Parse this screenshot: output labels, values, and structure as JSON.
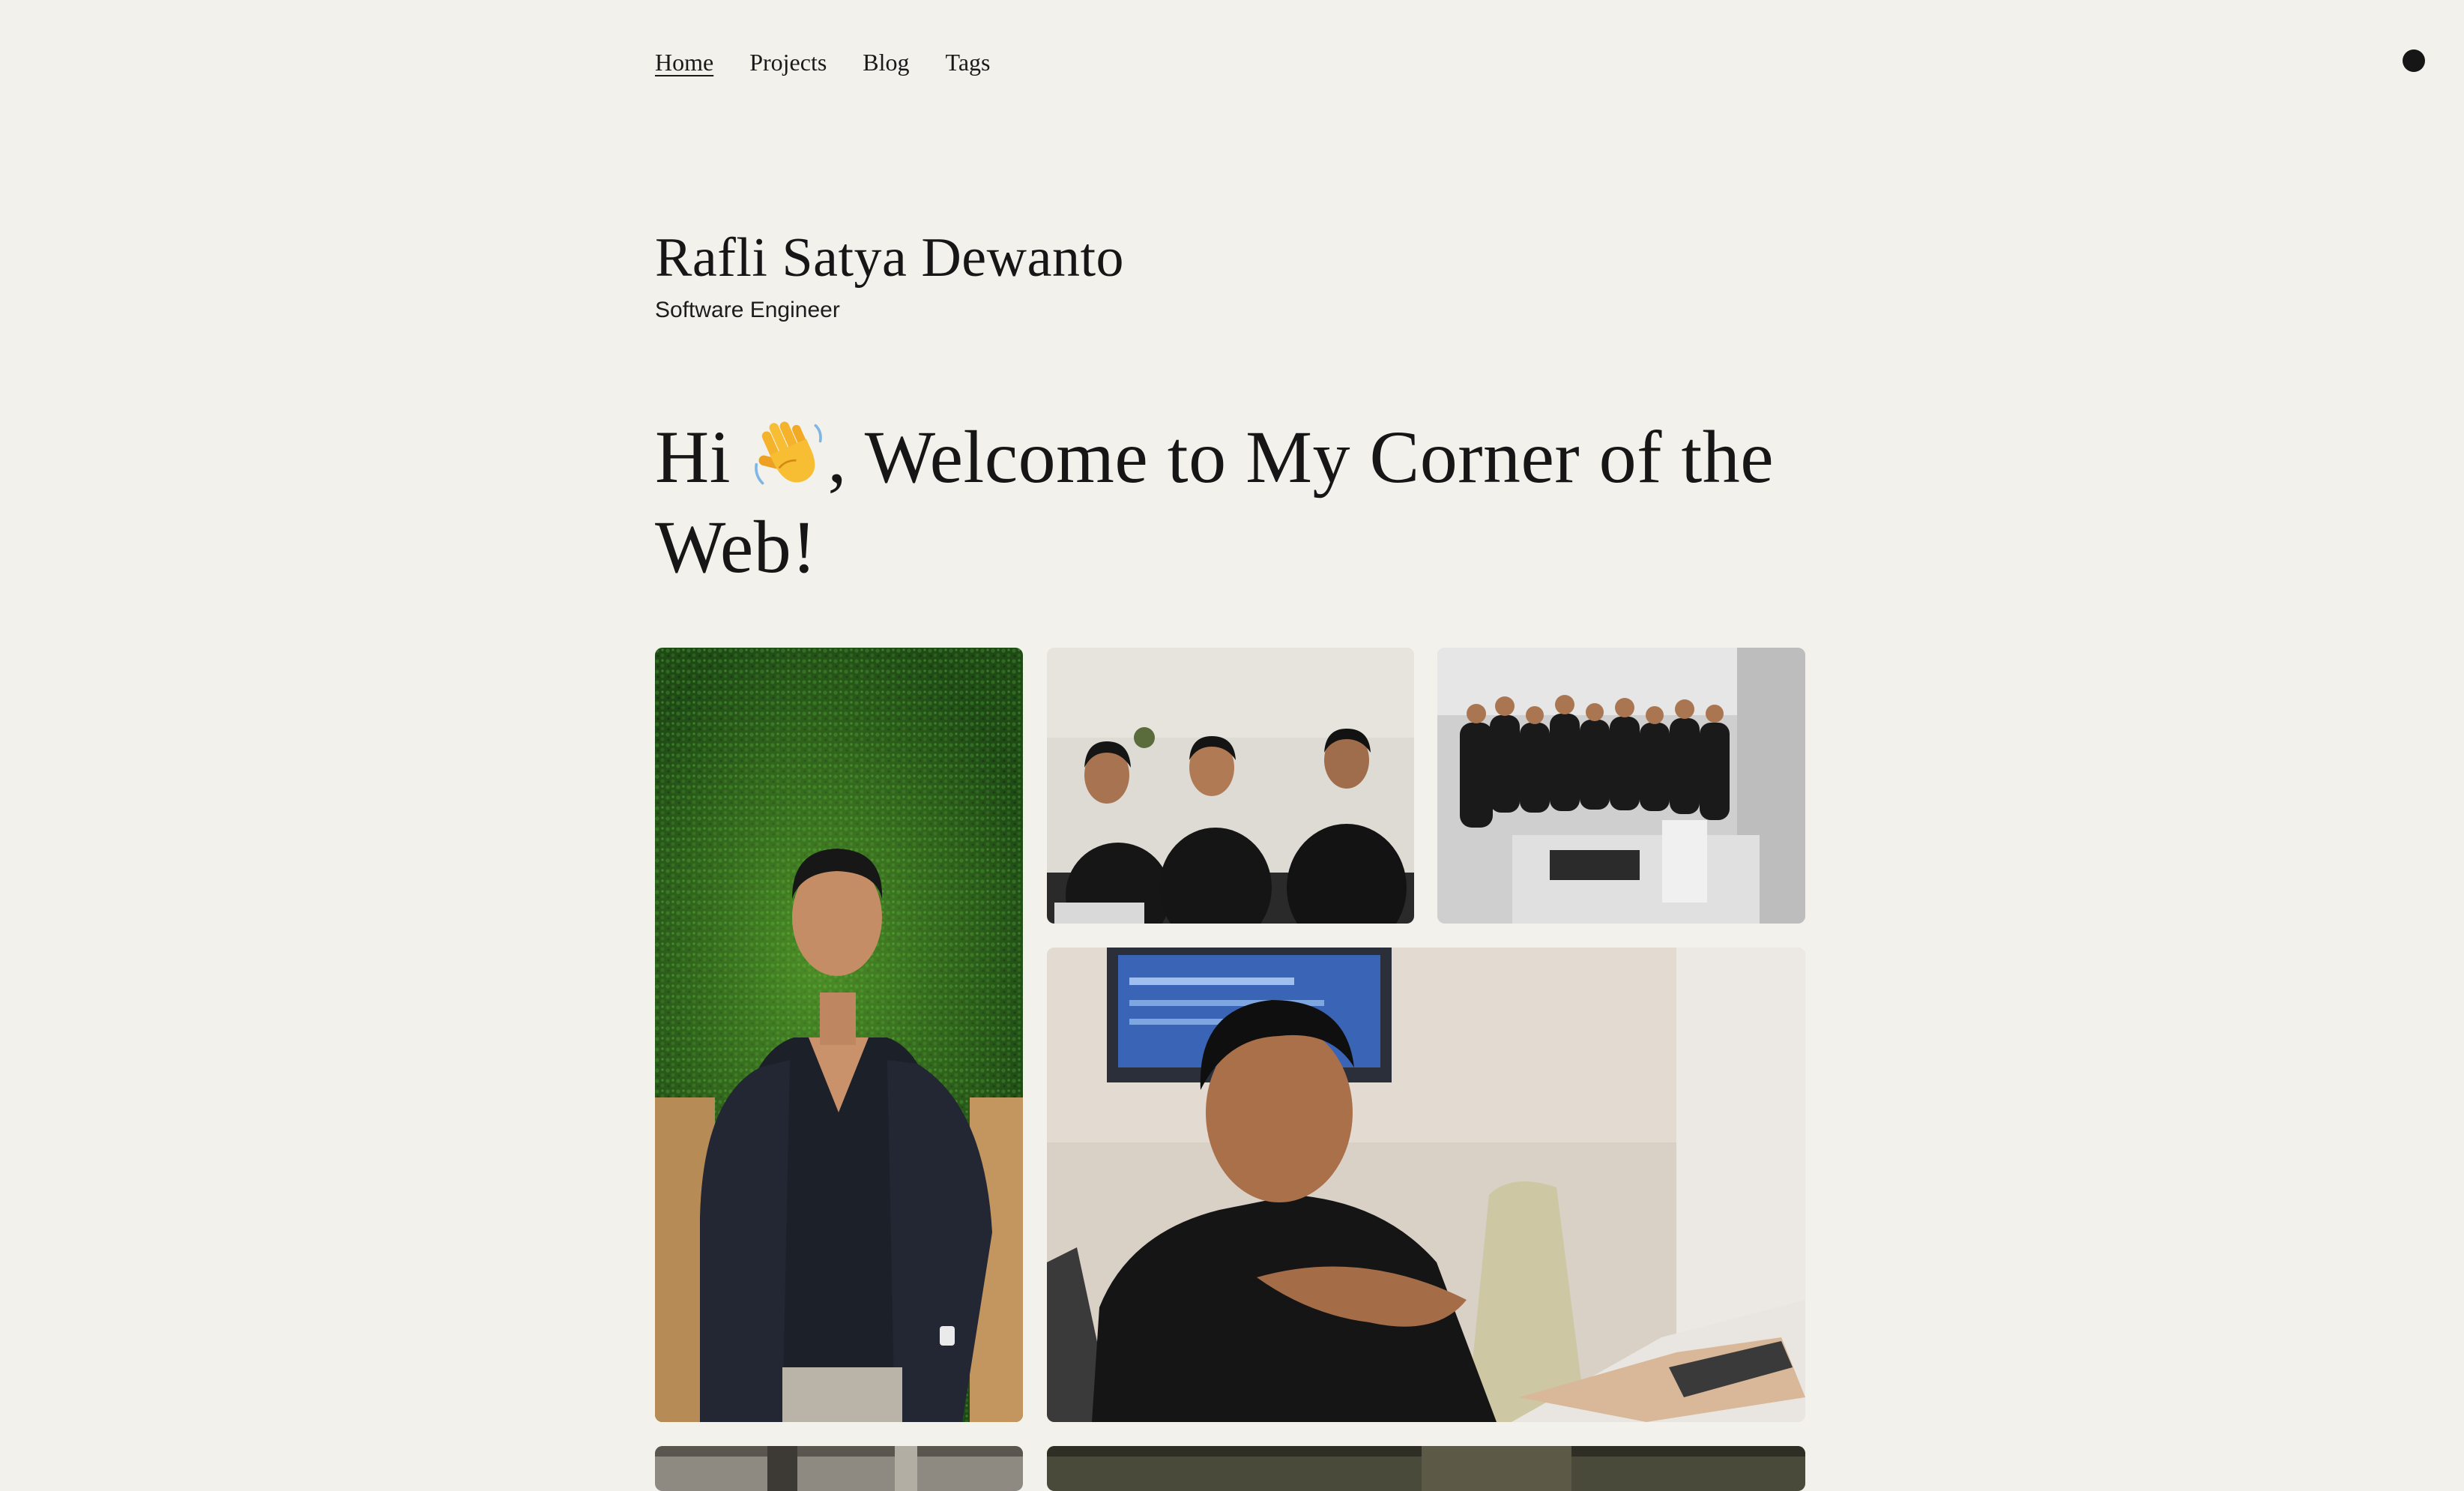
{
  "nav": {
    "items": [
      {
        "label": "Home",
        "active": true
      },
      {
        "label": "Projects",
        "active": false
      },
      {
        "label": "Blog",
        "active": false
      },
      {
        "label": "Tags",
        "active": false
      }
    ],
    "theme_toggle_icon": "theme-toggle-circle-icon"
  },
  "header": {
    "name": "Rafli Satya Dewanto",
    "role": "Software Engineer"
  },
  "welcome": {
    "heading_before_emoji": "Hi ",
    "emoji": "👋",
    "heading_after_emoji": ", Welcome to My Corner of the Web!"
  },
  "gallery": {
    "photos": [
      {
        "name": "portrait-green-wall"
      },
      {
        "name": "three-friends-photo"
      },
      {
        "name": "team-group-photo"
      },
      {
        "name": "man-at-laptop-photo"
      },
      {
        "name": "gallery-photo-5"
      },
      {
        "name": "gallery-photo-6"
      }
    ]
  },
  "colors": {
    "background": "#f2f1ec",
    "text": "#161616"
  }
}
